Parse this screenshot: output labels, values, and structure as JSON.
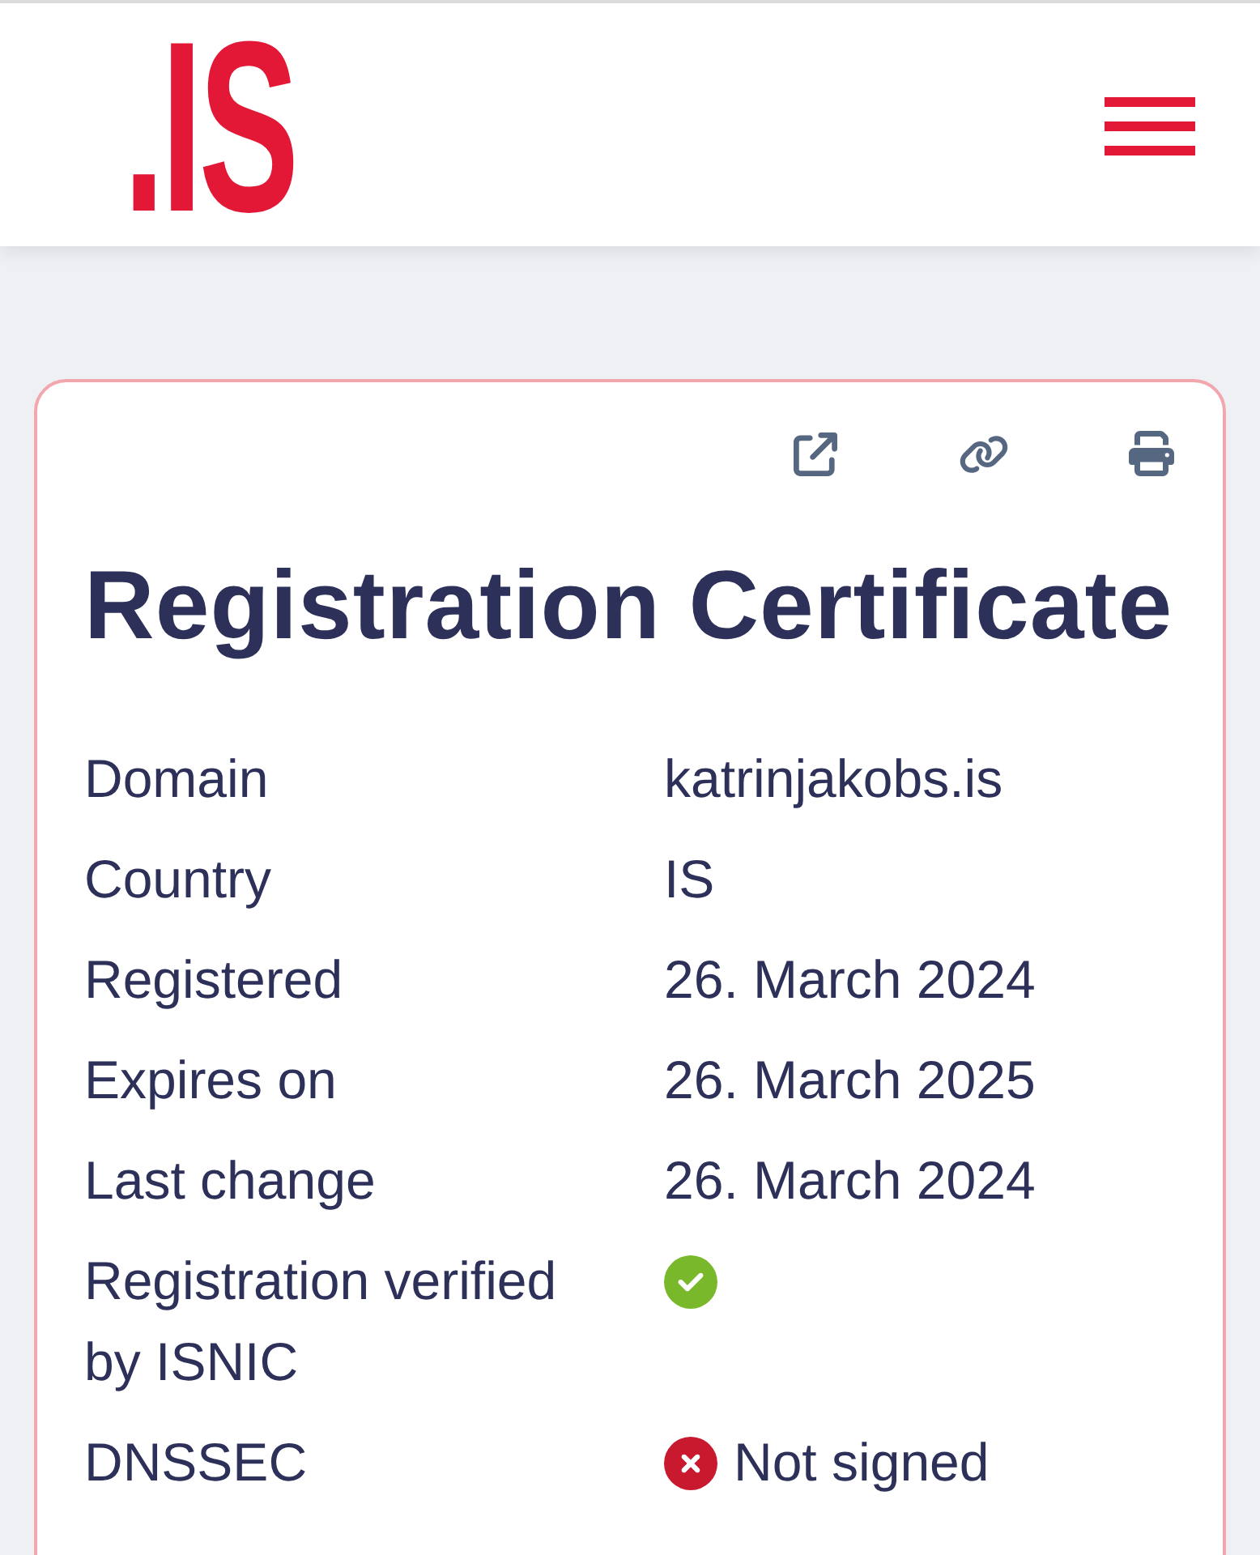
{
  "header": {
    "logo": ".IS"
  },
  "certificate": {
    "title": "Registration Certificate",
    "rows": [
      {
        "kind": "text",
        "label": "Domain",
        "value": "katrinjakobs.is"
      },
      {
        "kind": "text",
        "label": "Country",
        "value": "IS"
      },
      {
        "kind": "text",
        "label": "Registered",
        "value": "26. March 2024"
      },
      {
        "kind": "text",
        "label": "Expires on",
        "value": "26. March 2025"
      },
      {
        "kind": "text",
        "label": "Last change",
        "value": "26. March 2024"
      },
      {
        "kind": "status",
        "label": "Registration verified by ISNIC",
        "ok": true
      },
      {
        "kind": "status",
        "label": "DNSSEC",
        "ok": false,
        "value": "Not signed"
      }
    ]
  }
}
